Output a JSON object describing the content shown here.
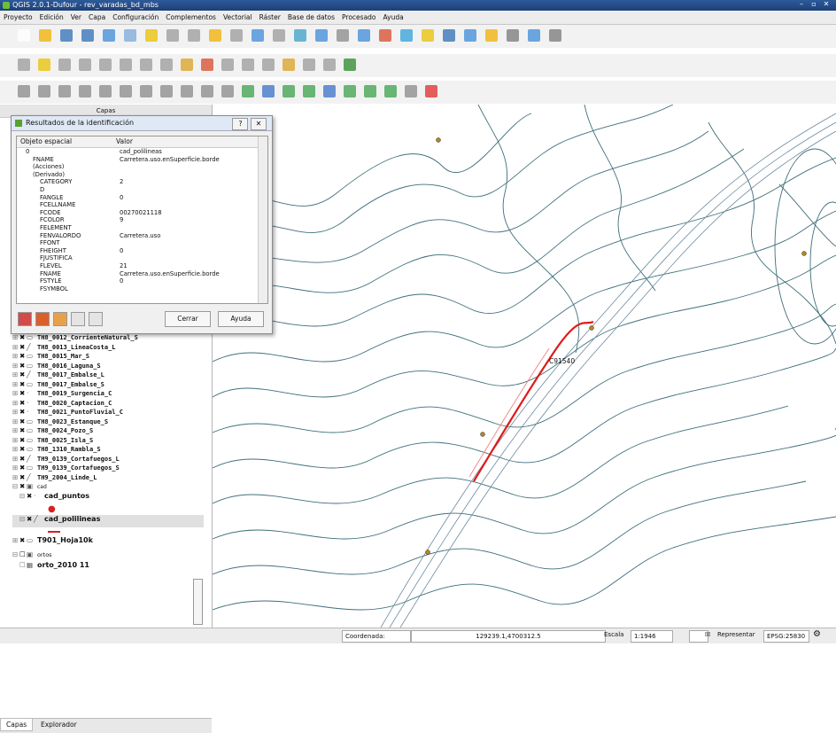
{
  "window": {
    "title": "QGIS 2.0.1-Dufour - rev_varadas_bd_mbs"
  },
  "menu": [
    "Proyecto",
    "Edición",
    "Ver",
    "Capa",
    "Configuración",
    "Complementos",
    "Vectorial",
    "Ráster",
    "Base de datos",
    "Procesado",
    "Ayuda"
  ],
  "panel": {
    "title": "Capas",
    "layers": [
      {
        "name": "TH8_0012_CorrienteNatural_S",
        "kind": "poly"
      },
      {
        "name": "TH8_0013_LineaCosta_L",
        "kind": "line"
      },
      {
        "name": "TH8_0015_Mar_S",
        "kind": "poly"
      },
      {
        "name": "TH8_0016_Laguna_S",
        "kind": "poly"
      },
      {
        "name": "TH8_0017_Embalse_L",
        "kind": "line"
      },
      {
        "name": "TH8_0017_Embalse_S",
        "kind": "poly"
      },
      {
        "name": "TH8_0019_Surgencia_C",
        "kind": "point"
      },
      {
        "name": "TH8_0020_Captacion_C",
        "kind": "point"
      },
      {
        "name": "TH8_0021_PuntoFluvial_C",
        "kind": "point"
      },
      {
        "name": "TH8_0023_Estanque_S",
        "kind": "poly"
      },
      {
        "name": "TH8_0024_Pozo_S",
        "kind": "poly"
      },
      {
        "name": "TH8_0025_Isla_S",
        "kind": "poly"
      },
      {
        "name": "TH8_1310_Rambla_S",
        "kind": "poly"
      },
      {
        "name": "TH9_0139_Cortafuegos_L",
        "kind": "line"
      },
      {
        "name": "TH9_0139_Cortafuegos_S",
        "kind": "poly"
      },
      {
        "name": "TH9_2004_Linde_L",
        "kind": "line"
      }
    ],
    "group_cad": "cad",
    "cad_points": "cad_puntos",
    "cad_lines": "cad_polilineas",
    "t901": "T901_Hoja10k",
    "orto_group": "ortos",
    "orto_layer": "orto_2010 11",
    "tabs": [
      "Capas",
      "Explorador"
    ]
  },
  "identify": {
    "title": "Resultados de la identificación",
    "col_object": "Objeto espacial",
    "col_value": "Valor",
    "rows": [
      {
        "k": "0",
        "v": "cad_polilineas"
      },
      {
        "k": "FNAME",
        "v": "Carretera.uso.enSuperficie.borde"
      },
      {
        "k": "(Acciones)",
        "v": ""
      },
      {
        "k": "(Derivado)",
        "v": ""
      },
      {
        "k": "CATEGORY",
        "v": "2"
      },
      {
        "k": "D",
        "v": ""
      },
      {
        "k": "FANGLE",
        "v": "0"
      },
      {
        "k": "FCELLNAME",
        "v": ""
      },
      {
        "k": "FCODE",
        "v": "00270021118"
      },
      {
        "k": "FCOLOR",
        "v": "9"
      },
      {
        "k": "FELEMENT",
        "v": ""
      },
      {
        "k": "FENVALORDO",
        "v": "Carretera.uso"
      },
      {
        "k": "FFONT",
        "v": ""
      },
      {
        "k": "FHEIGHT",
        "v": "0"
      },
      {
        "k": "FJUSTIFICA",
        "v": ""
      },
      {
        "k": "FLEVEL",
        "v": "21"
      },
      {
        "k": "FNAME",
        "v": "Carretera.uso.enSuperficie.borde"
      },
      {
        "k": "FSTYLE",
        "v": "0"
      },
      {
        "k": "FSYMBOL",
        "v": ""
      }
    ],
    "btn_close": "Cerrar",
    "btn_help": "Ayuda"
  },
  "map": {
    "feature_label": "C91540"
  },
  "status": {
    "coord_label": "Coordenada:",
    "coord_value": "129239.1,4700312.5",
    "scale_label": "Escala",
    "scale_value": "1:1946",
    "render_label": "Representar",
    "crs": "EPSG:25830"
  },
  "colors": {
    "road_highlight": "#e01a1a",
    "contour": "#3f6f7a",
    "point": "#b5861e"
  }
}
